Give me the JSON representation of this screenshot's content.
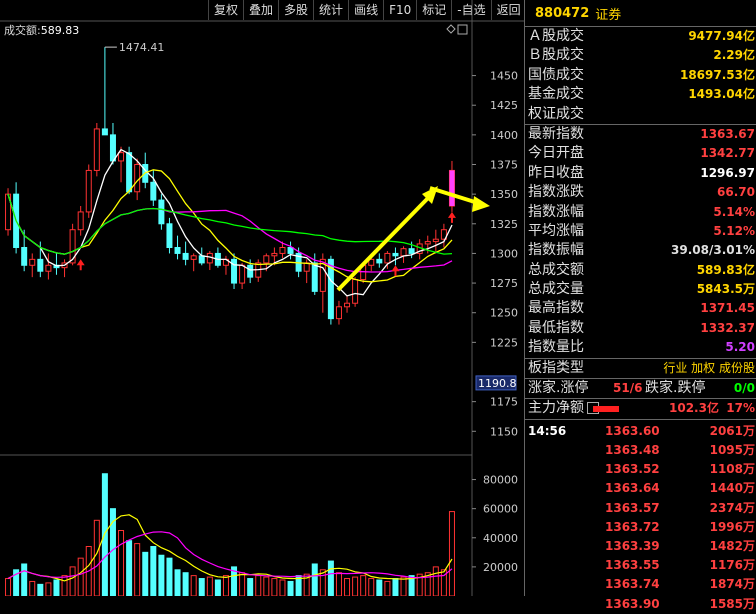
{
  "toolbar": {
    "items": [
      "复权",
      "叠加",
      "多股",
      "统计",
      "画线",
      "F10",
      "标记",
      "-自选",
      "返回"
    ]
  },
  "chart": {
    "volume_label": "成交额:",
    "volume_value": "589.83",
    "peak_label": "1474.41",
    "current_price_tag": "1190.8",
    "price_axis": [
      "1450",
      "1425",
      "1400",
      "1375",
      "1350",
      "1325",
      "1300",
      "1275",
      "1250",
      "1225",
      "1175",
      "1150"
    ],
    "vol_axis": [
      "80000",
      "60000",
      "40000",
      "20000"
    ],
    "colors": {
      "up": "#ff3232",
      "down": "#54ffff",
      "ma5": "#ffffff",
      "ma10": "#ffff00",
      "ma20": "#ff00ff",
      "ma60": "#00ff00",
      "arrow": "#ffff00"
    }
  },
  "chart_data": {
    "type": "candlestick",
    "y_range": [
      1130,
      1480
    ],
    "candles": [
      [
        1320,
        1355,
        1315,
        1350
      ],
      [
        1350,
        1360,
        1300,
        1305
      ],
      [
        1305,
        1320,
        1285,
        1290
      ],
      [
        1290,
        1300,
        1280,
        1295
      ],
      [
        1295,
        1310,
        1280,
        1285
      ],
      [
        1285,
        1300,
        1278,
        1290
      ],
      [
        1290,
        1300,
        1282,
        1288
      ],
      [
        1288,
        1295,
        1280,
        1292
      ],
      [
        1292,
        1325,
        1290,
        1320
      ],
      [
        1320,
        1340,
        1315,
        1335
      ],
      [
        1335,
        1375,
        1330,
        1370
      ],
      [
        1370,
        1410,
        1365,
        1405
      ],
      [
        1405,
        1474,
        1400,
        1400
      ],
      [
        1400,
        1410,
        1375,
        1378
      ],
      [
        1378,
        1390,
        1360,
        1385
      ],
      [
        1385,
        1390,
        1350,
        1352
      ],
      [
        1352,
        1380,
        1345,
        1375
      ],
      [
        1375,
        1385,
        1355,
        1360
      ],
      [
        1360,
        1370,
        1340,
        1345
      ],
      [
        1345,
        1350,
        1320,
        1325
      ],
      [
        1325,
        1330,
        1300,
        1305
      ],
      [
        1305,
        1315,
        1295,
        1300
      ],
      [
        1300,
        1310,
        1290,
        1295
      ],
      [
        1295,
        1300,
        1285,
        1298
      ],
      [
        1298,
        1305,
        1290,
        1292
      ],
      [
        1292,
        1302,
        1286,
        1300
      ],
      [
        1300,
        1305,
        1288,
        1290
      ],
      [
        1290,
        1298,
        1282,
        1295
      ],
      [
        1295,
        1300,
        1270,
        1275
      ],
      [
        1275,
        1292,
        1270,
        1290
      ],
      [
        1290,
        1295,
        1275,
        1280
      ],
      [
        1280,
        1295,
        1276,
        1292
      ],
      [
        1292,
        1300,
        1285,
        1298
      ],
      [
        1298,
        1305,
        1290,
        1300
      ],
      [
        1300,
        1310,
        1296,
        1305
      ],
      [
        1305,
        1310,
        1295,
        1300
      ],
      [
        1300,
        1305,
        1280,
        1285
      ],
      [
        1285,
        1295,
        1275,
        1292
      ],
      [
        1292,
        1300,
        1265,
        1268
      ],
      [
        1268,
        1300,
        1250,
        1295
      ],
      [
        1295,
        1298,
        1240,
        1245
      ],
      [
        1245,
        1260,
        1240,
        1255
      ],
      [
        1255,
        1265,
        1250,
        1258
      ],
      [
        1258,
        1280,
        1255,
        1278
      ],
      [
        1278,
        1292,
        1275,
        1290
      ],
      [
        1290,
        1300,
        1285,
        1295
      ],
      [
        1295,
        1300,
        1288,
        1292
      ],
      [
        1292,
        1302,
        1287,
        1300
      ],
      [
        1300,
        1305,
        1290,
        1298
      ],
      [
        1298,
        1306,
        1292,
        1304
      ],
      [
        1304,
        1310,
        1296,
        1300
      ],
      [
        1300,
        1312,
        1295,
        1308
      ],
      [
        1308,
        1315,
        1300,
        1310
      ],
      [
        1310,
        1320,
        1300,
        1312
      ],
      [
        1312,
        1325,
        1305,
        1320
      ],
      [
        1340,
        1378,
        1335,
        1370
      ]
    ],
    "volumes": [
      12,
      18,
      22,
      10,
      8,
      9,
      11,
      14,
      20,
      26,
      34,
      52,
      84,
      60,
      45,
      38,
      36,
      30,
      34,
      28,
      26,
      18,
      16,
      14,
      12,
      13,
      11,
      14,
      20,
      16,
      12,
      14,
      13,
      12,
      11,
      10,
      14,
      15,
      22,
      18,
      24,
      16,
      12,
      13,
      14,
      12,
      11,
      10,
      12,
      13,
      14,
      15,
      16,
      20,
      18,
      58
    ]
  },
  "info": {
    "code": "880472",
    "name": "证券",
    "rows1": [
      {
        "label": "Ａ股成交",
        "value": "9477.94亿",
        "color": "#ffd500"
      },
      {
        "label": "Ｂ股成交",
        "value": "2.29亿",
        "color": "#ffd500"
      },
      {
        "label": "国债成交",
        "value": "18697.53亿",
        "color": "#ffd500"
      },
      {
        "label": "基金成交",
        "value": "1493.04亿",
        "color": "#ffd500"
      },
      {
        "label": "权证成交",
        "value": "",
        "color": "#ffd500"
      }
    ],
    "rows2": [
      {
        "label": "最新指数",
        "value": "1363.67",
        "color": "#ff4040"
      },
      {
        "label": "今日开盘",
        "value": "1342.77",
        "color": "#ff4040"
      },
      {
        "label": "昨日收盘",
        "value": "1296.97",
        "color": "#ffffff"
      },
      {
        "label": "指数涨跌",
        "value": "66.70",
        "color": "#ff4040"
      },
      {
        "label": "指数涨幅",
        "value": "5.14%",
        "color": "#ff4040"
      },
      {
        "label": "平均涨幅",
        "value": "5.12%",
        "color": "#ff4040"
      },
      {
        "label": "指数振幅",
        "value": "39.08/3.01%",
        "color": "#e0e0e0"
      },
      {
        "label": "总成交额",
        "value": "589.83亿",
        "color": "#ffd500"
      },
      {
        "label": "总成交量",
        "value": "5843.5万",
        "color": "#ffd500"
      },
      {
        "label": "最高指数",
        "value": "1371.45",
        "color": "#ff4040"
      },
      {
        "label": "最低指数",
        "value": "1332.37",
        "color": "#ff4040"
      },
      {
        "label": "指数量比",
        "value": "5.20",
        "color": "#d040ff"
      }
    ],
    "board_type_label": "板指类型",
    "board_type_value": "行业 加权 成份股",
    "limit_label": "涨家.涨停",
    "limit_value": "51/6",
    "fall_label": "跌家.跌停",
    "fall_value": "0/0",
    "net_label": "主力净额",
    "net_value": "102.3亿",
    "net_pct": "17%",
    "ticks": [
      {
        "time": "14:56",
        "price": "1363.60",
        "vol": "2061万"
      },
      {
        "time": "",
        "price": "1363.48",
        "vol": "1095万"
      },
      {
        "time": "",
        "price": "1363.52",
        "vol": "1108万"
      },
      {
        "time": "",
        "price": "1363.64",
        "vol": "1440万"
      },
      {
        "time": "",
        "price": "1363.57",
        "vol": "2374万"
      },
      {
        "time": "",
        "price": "1363.72",
        "vol": "1996万"
      },
      {
        "time": "",
        "price": "1363.39",
        "vol": "1482万"
      },
      {
        "time": "",
        "price": "1363.55",
        "vol": "1176万"
      },
      {
        "time": "",
        "price": "1363.74",
        "vol": "1874万"
      },
      {
        "time": "",
        "price": "1363.90",
        "vol": "1585万"
      }
    ]
  }
}
